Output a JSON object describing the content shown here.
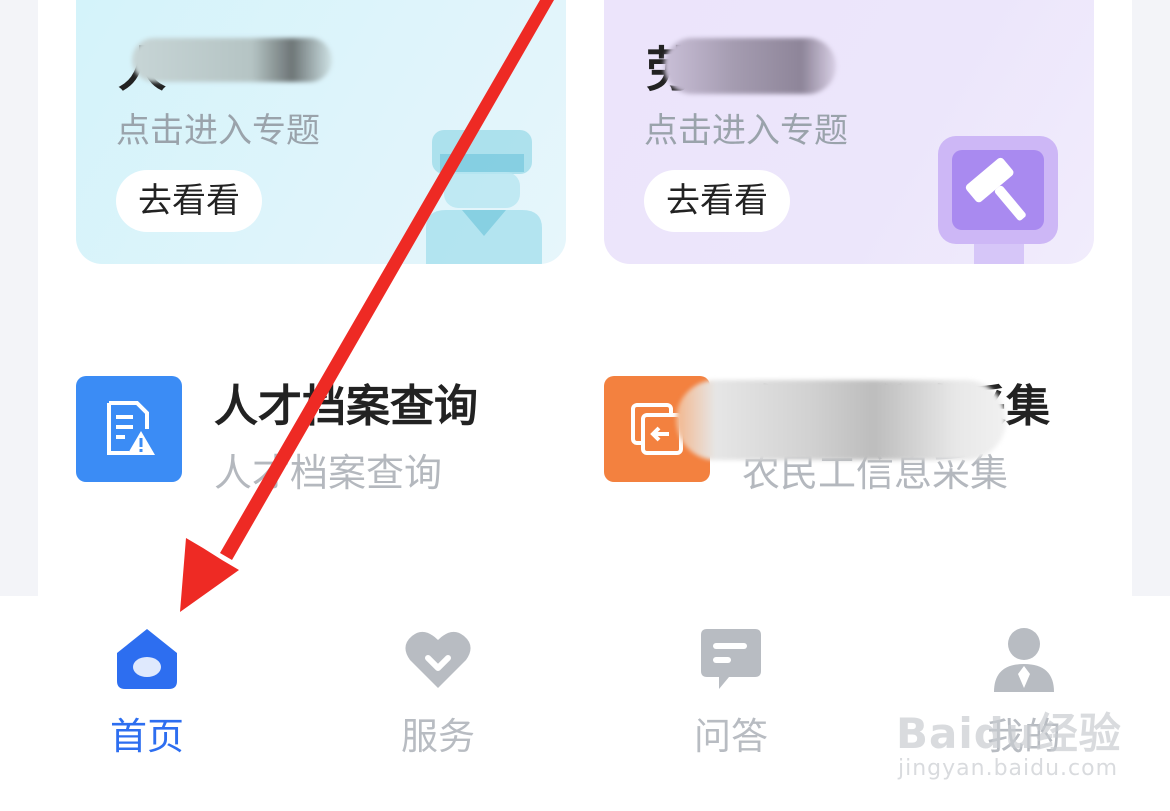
{
  "cards": [
    {
      "title": "人",
      "subtitle": "点击进入专题",
      "button": "去看看",
      "accent": "#d4f3fa"
    },
    {
      "title": "劳",
      "subtitle": "点击进入专题",
      "button": "去看看",
      "accent": "#ece4fb"
    }
  ],
  "services": [
    {
      "title": "人才档案查询",
      "subtitle": "人才档案查询",
      "icon": "document-warning-icon",
      "color": "#3b8cf5"
    },
    {
      "title": "农民工信息采集",
      "subtitle": "农民工信息采集",
      "icon": "import-icon",
      "color": "#f3813f"
    }
  ],
  "tabs": [
    {
      "label": "首页",
      "icon": "home-icon",
      "active": true
    },
    {
      "label": "服务",
      "icon": "heart-icon",
      "active": false
    },
    {
      "label": "问答",
      "icon": "chat-icon",
      "active": false
    },
    {
      "label": "我的",
      "icon": "user-icon",
      "active": false
    }
  ],
  "colors": {
    "active": "#2d6ef0",
    "inactive": "#b8bcc2",
    "annotation_arrow": "#ee2a24"
  },
  "watermark": {
    "logo": "Baidu经验",
    "url": "jingyan.baidu.com"
  }
}
